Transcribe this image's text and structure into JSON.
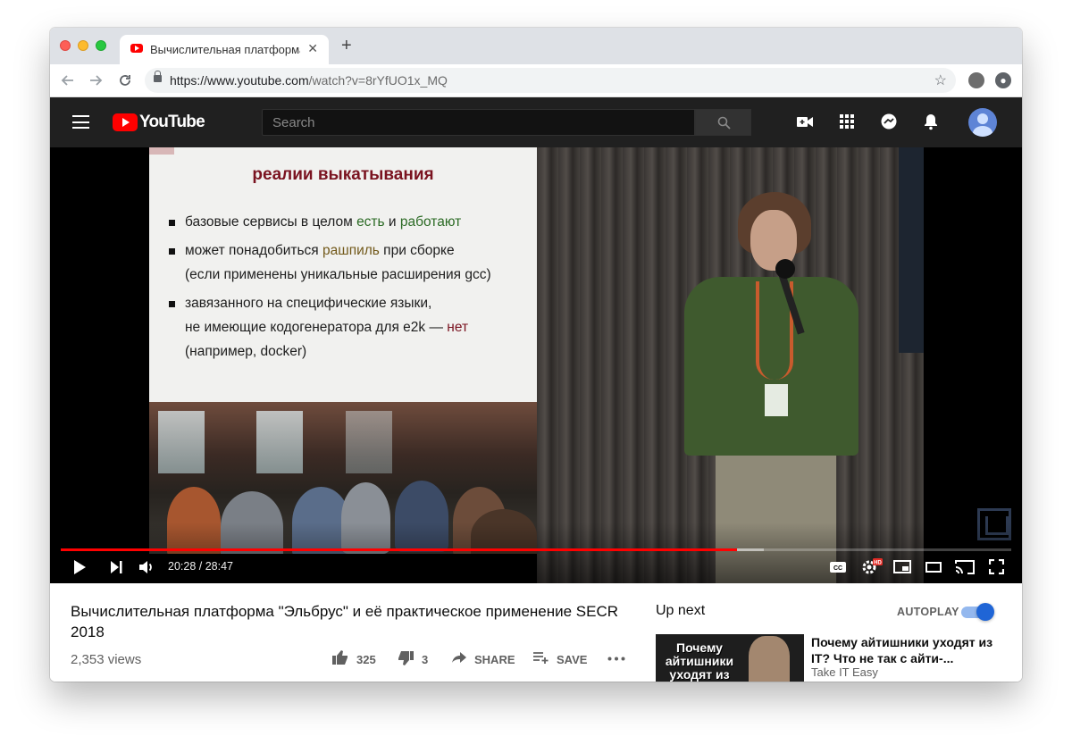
{
  "browser": {
    "tab_title": "Вычислительная платформа \"",
    "new_tab_label": "+",
    "close_glyph": "✕",
    "url_host": "https://www.youtube.com",
    "url_path": "/watch?v=8rYfUO1x_MQ"
  },
  "masthead": {
    "logo_text": "YouTube",
    "search_placeholder": "Search"
  },
  "slide": {
    "title": "реалии выкатывания",
    "b1_a": "базовые сервисы в целом ",
    "b1_b": "есть",
    "b1_c": " и ",
    "b1_d": "работают",
    "b2_a": "может понадобиться ",
    "b2_b": "рашпиль",
    "b2_c": " при сборке",
    "b2_line2": "(если применены уникальные расширения gcc)",
    "b3_line1": "завязанного на специфические языки,",
    "b3_line2a": "не имеющие кодогенератора для e2k — ",
    "b3_line2b": "нет",
    "b3_line3": "(например, docker)"
  },
  "player": {
    "time_display": "20:28 / 28:47",
    "played_fraction": 0.7114,
    "buffered_fraction": 0.74
  },
  "video": {
    "title": "Вычислительная платформа \"Эльбрус\" и её практическое применение SECR 2018",
    "views": "2,353 views",
    "likes": "325",
    "dislikes": "3",
    "share_label": "SHARE",
    "save_label": "SAVE"
  },
  "sidebar": {
    "up_next_label": "Up next",
    "autoplay_label": "AUTOPLAY",
    "autoplay_on": true,
    "rec": {
      "thumb_text": "Почему айтишники уходят из",
      "title": "Почему айтишники уходят из IT? Что не так с айти-...",
      "channel": "Take IT Easy"
    }
  },
  "colors": {
    "accent": "#ff0000",
    "masthead_bg": "#202020",
    "toggle_blue": "#1f65d6"
  }
}
